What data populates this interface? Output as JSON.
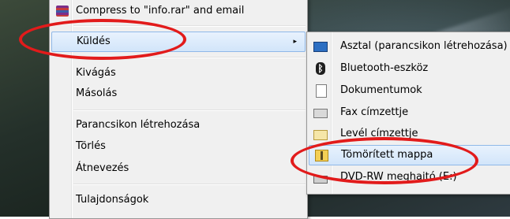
{
  "main_menu": {
    "items": [
      {
        "label": "Compress to \"info.rar\" and email"
      },
      {
        "label": "Küldés",
        "arrow": "▸"
      },
      {
        "label": "Kivágás"
      },
      {
        "label": "Másolás"
      },
      {
        "label": "Parancsikon létrehozása"
      },
      {
        "label": "Törlés"
      },
      {
        "label": "Átnevezés"
      },
      {
        "label": "Tulajdonságok"
      }
    ]
  },
  "send_to_menu": {
    "items": [
      {
        "label": "Asztal (parancsikon létrehozása)",
        "icon": "desktop-icon"
      },
      {
        "label": "Bluetooth-eszköz",
        "icon": "bluetooth-icon"
      },
      {
        "label": "Dokumentumok",
        "icon": "documents-icon"
      },
      {
        "label": "Fax címzettje",
        "icon": "fax-icon"
      },
      {
        "label": "Levél címzettje",
        "icon": "mail-icon"
      },
      {
        "label": "Tömörített mappa",
        "icon": "zip-folder-icon"
      },
      {
        "label": "DVD-RW meghajtó (E:)",
        "icon": "dvd-drive-icon"
      }
    ]
  },
  "annotation_color": "#e21b1b",
  "highlight_color": "#d2e5fa"
}
